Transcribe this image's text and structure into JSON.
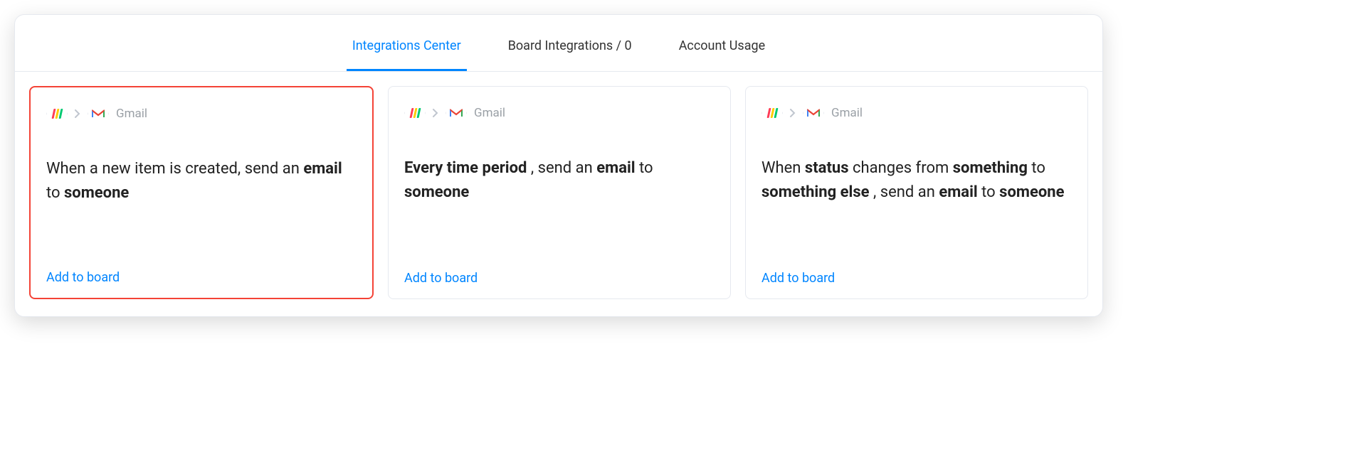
{
  "tabs": [
    {
      "label": "Integrations Center",
      "active": true
    },
    {
      "label": "Board Integrations / 0",
      "active": false
    },
    {
      "label": "Account Usage",
      "active": false
    }
  ],
  "integration_name": "Gmail",
  "add_to_board_label": "Add to board",
  "recipes": [
    {
      "highlight": true,
      "parts": [
        {
          "t": "When a new item is created, send an ",
          "b": false
        },
        {
          "t": "email",
          "b": true
        },
        {
          "t": " to ",
          "b": false
        },
        {
          "t": "someone",
          "b": true
        }
      ]
    },
    {
      "highlight": false,
      "parts": [
        {
          "t": "Every time period",
          "b": true
        },
        {
          "t": " , send an ",
          "b": false
        },
        {
          "t": "email",
          "b": true
        },
        {
          "t": " to ",
          "b": false
        },
        {
          "t": "someone",
          "b": true
        }
      ]
    },
    {
      "highlight": false,
      "parts": [
        {
          "t": "When ",
          "b": false
        },
        {
          "t": "status",
          "b": true
        },
        {
          "t": " changes from ",
          "b": false
        },
        {
          "t": "something",
          "b": true
        },
        {
          "t": " to ",
          "b": false
        },
        {
          "t": "something else",
          "b": true
        },
        {
          "t": " , send an ",
          "b": false
        },
        {
          "t": "email",
          "b": true
        },
        {
          "t": " to ",
          "b": false
        },
        {
          "t": "someone",
          "b": true
        }
      ]
    }
  ]
}
